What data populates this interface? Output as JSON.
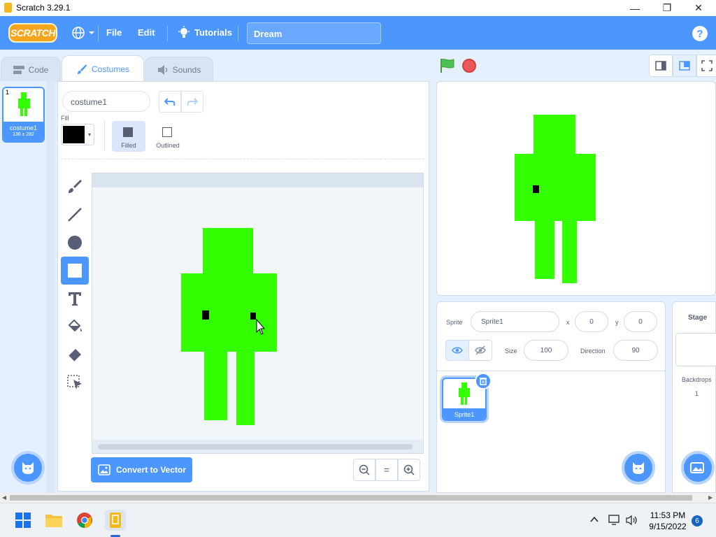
{
  "window": {
    "title": "Scratch 3.29.1",
    "minimize": "—",
    "maximize": "❐",
    "close": "✕"
  },
  "menubar": {
    "logo": "SCRATCH",
    "file": "File",
    "edit": "Edit",
    "tutorials": "Tutorials",
    "project_title": "Dream",
    "help": "?"
  },
  "tabs": {
    "code": "Code",
    "costumes": "Costumes",
    "sounds": "Sounds"
  },
  "costume_list": [
    {
      "number": "1",
      "name": "costume1",
      "size": "136 x 282"
    }
  ],
  "paint_editor": {
    "costume_name": "costume1",
    "fill_label": "Fill",
    "fill_color": "#000000",
    "mode_filled": "Filled",
    "mode_outlined": "Outlined",
    "convert_button": "Convert to Vector",
    "zoom_reset": "="
  },
  "sprite_figure_color": "#33ff00",
  "sprite_panel": {
    "sprite_label": "Sprite",
    "sprite_name": "Sprite1",
    "x_label": "x",
    "x_value": "0",
    "y_label": "y",
    "y_value": "0",
    "size_label": "Size",
    "size_value": "100",
    "direction_label": "Direction",
    "direction_value": "90",
    "sprites": [
      {
        "name": "Sprite1"
      }
    ]
  },
  "stage_panel": {
    "title": "Stage",
    "backdrops_label": "Backdrops",
    "backdrops_count": "1"
  },
  "taskbar": {
    "time": "11:53 PM",
    "date": "9/15/2022",
    "notifications": "6"
  }
}
